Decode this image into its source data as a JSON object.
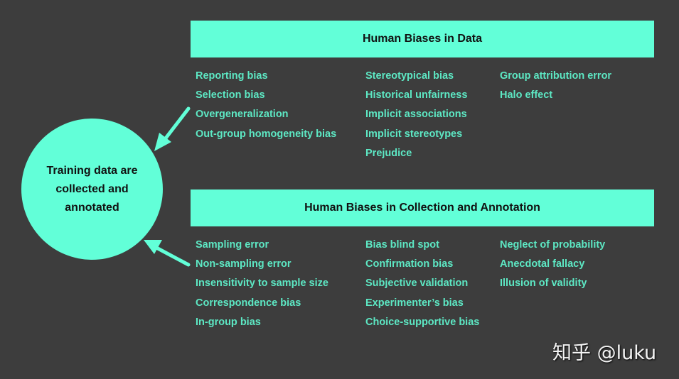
{
  "center_node": {
    "label": "Training data are collected and annotated"
  },
  "sections": [
    {
      "title": "Human Biases in Data",
      "columns": [
        [
          "Reporting bias",
          "Selection bias",
          "Overgeneralization",
          "Out-group homogeneity bias"
        ],
        [
          "Stereotypical bias",
          "Historical unfairness",
          "Implicit associations",
          "Implicit stereotypes",
          "Prejudice"
        ],
        [
          "Group attribution error",
          "Halo effect"
        ]
      ]
    },
    {
      "title": "Human Biases in Collection and Annotation",
      "columns": [
        [
          "Sampling error",
          "Non-sampling error",
          "Insensitivity to sample size",
          "Correspondence bias",
          "In-group bias"
        ],
        [
          "Bias blind spot",
          "Confirmation bias",
          "Subjective validation",
          "Experimenter’s bias",
          "Choice-supportive bias"
        ],
        [
          "Neglect of probability",
          "Anecdotal fallacy",
          "Illusion of validity"
        ]
      ]
    }
  ],
  "colors": {
    "background": "#3d3d3d",
    "accent": "#62ffd8",
    "item_text": "#5de8c4",
    "header_text": "#111111"
  },
  "watermark": "知乎 @luku"
}
